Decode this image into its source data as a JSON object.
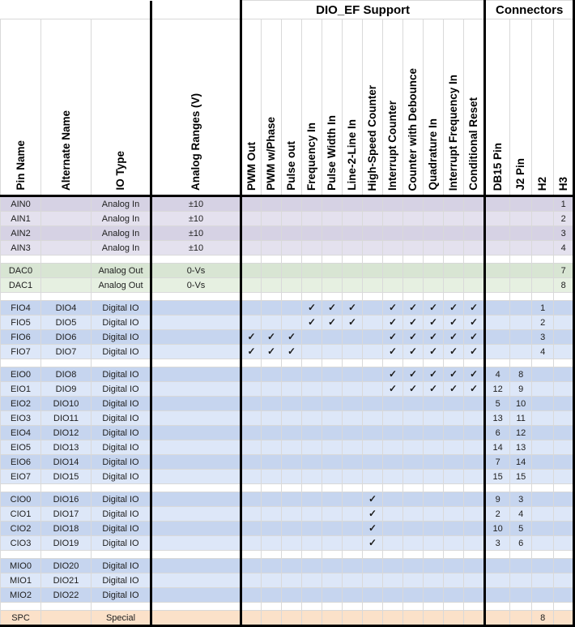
{
  "banners": {
    "dio_ef": "DIO_EF Support",
    "connectors": "Connectors"
  },
  "headers": {
    "pin_name": "Pin Name",
    "alternate_name": "Alternate Name",
    "io_type": "IO Type",
    "analog_ranges": "Analog Ranges (V)",
    "dio_ef": [
      "PWM Out",
      "PWM w/Phase",
      "Pulse out",
      "Frequency In",
      "Pulse Width In",
      "Line-2-Line In",
      "High-Speed Counter",
      "Interrupt Counter",
      "Counter with Debounce",
      "Quadrature In",
      "Interrupt Frequency In",
      "Conditional Reset"
    ],
    "connectors": [
      "DB15 Pin",
      "J2 Pin",
      "H2",
      "H3"
    ]
  },
  "check_glyph": "✓",
  "colors": {
    "analog_in_a": "#d6d2e4",
    "analog_in_b": "#e4e1ee",
    "analog_out_a": "#d8e5d3",
    "analog_out_b": "#e6f0e1",
    "digital_a": "#c6d5ef",
    "digital_b": "#dde7f8",
    "special": "#fbe1c9",
    "grid": "#d9d9d9",
    "section_border": "#000000"
  },
  "groups": [
    {
      "id": "analog-in",
      "tint": "ain",
      "rows": [
        {
          "pin": "AIN0",
          "alt": "",
          "io": "Analog In",
          "range": "±10",
          "ef": [
            0,
            0,
            0,
            0,
            0,
            0,
            0,
            0,
            0,
            0,
            0,
            0
          ],
          "conn": [
            "",
            "",
            "",
            "1"
          ]
        },
        {
          "pin": "AIN1",
          "alt": "",
          "io": "Analog In",
          "range": "±10",
          "ef": [
            0,
            0,
            0,
            0,
            0,
            0,
            0,
            0,
            0,
            0,
            0,
            0
          ],
          "conn": [
            "",
            "",
            "",
            "2"
          ]
        },
        {
          "pin": "AIN2",
          "alt": "",
          "io": "Analog In",
          "range": "±10",
          "ef": [
            0,
            0,
            0,
            0,
            0,
            0,
            0,
            0,
            0,
            0,
            0,
            0
          ],
          "conn": [
            "",
            "",
            "",
            "3"
          ]
        },
        {
          "pin": "AIN3",
          "alt": "",
          "io": "Analog In",
          "range": "±10",
          "ef": [
            0,
            0,
            0,
            0,
            0,
            0,
            0,
            0,
            0,
            0,
            0,
            0
          ],
          "conn": [
            "",
            "",
            "",
            "4"
          ]
        }
      ]
    },
    {
      "id": "analog-out",
      "tint": "dac",
      "rows": [
        {
          "pin": "DAC0",
          "alt": "",
          "io": "Analog Out",
          "range": "0-Vs",
          "ef": [
            0,
            0,
            0,
            0,
            0,
            0,
            0,
            0,
            0,
            0,
            0,
            0
          ],
          "conn": [
            "",
            "",
            "",
            "7"
          ]
        },
        {
          "pin": "DAC1",
          "alt": "",
          "io": "Analog Out",
          "range": "0-Vs",
          "ef": [
            0,
            0,
            0,
            0,
            0,
            0,
            0,
            0,
            0,
            0,
            0,
            0
          ],
          "conn": [
            "",
            "",
            "",
            "8"
          ]
        }
      ]
    },
    {
      "id": "fio",
      "tint": "dig",
      "rows": [
        {
          "pin": "FIO4",
          "alt": "DIO4",
          "io": "Digital IO",
          "range": "",
          "ef": [
            0,
            0,
            0,
            1,
            1,
            1,
            0,
            1,
            1,
            1,
            1,
            1
          ],
          "conn": [
            "",
            "",
            "1",
            ""
          ]
        },
        {
          "pin": "FIO5",
          "alt": "DIO5",
          "io": "Digital IO",
          "range": "",
          "ef": [
            0,
            0,
            0,
            1,
            1,
            1,
            0,
            1,
            1,
            1,
            1,
            1
          ],
          "conn": [
            "",
            "",
            "2",
            ""
          ]
        },
        {
          "pin": "FIO6",
          "alt": "DIO6",
          "io": "Digital IO",
          "range": "",
          "ef": [
            1,
            1,
            1,
            0,
            0,
            0,
            0,
            1,
            1,
            1,
            1,
            1
          ],
          "conn": [
            "",
            "",
            "3",
            ""
          ]
        },
        {
          "pin": "FIO7",
          "alt": "DIO7",
          "io": "Digital IO",
          "range": "",
          "ef": [
            1,
            1,
            1,
            0,
            0,
            0,
            0,
            1,
            1,
            1,
            1,
            1
          ],
          "conn": [
            "",
            "",
            "4",
            ""
          ]
        }
      ]
    },
    {
      "id": "eio",
      "tint": "dig",
      "rows": [
        {
          "pin": "EIO0",
          "alt": "DIO8",
          "io": "Digital IO",
          "range": "",
          "ef": [
            0,
            0,
            0,
            0,
            0,
            0,
            0,
            1,
            1,
            1,
            1,
            1
          ],
          "conn": [
            "4",
            "8",
            "",
            ""
          ]
        },
        {
          "pin": "EIO1",
          "alt": "DIO9",
          "io": "Digital IO",
          "range": "",
          "ef": [
            0,
            0,
            0,
            0,
            0,
            0,
            0,
            1,
            1,
            1,
            1,
            1
          ],
          "conn": [
            "12",
            "9",
            "",
            ""
          ]
        },
        {
          "pin": "EIO2",
          "alt": "DIO10",
          "io": "Digital IO",
          "range": "",
          "ef": [
            0,
            0,
            0,
            0,
            0,
            0,
            0,
            0,
            0,
            0,
            0,
            0
          ],
          "conn": [
            "5",
            "10",
            "",
            ""
          ]
        },
        {
          "pin": "EIO3",
          "alt": "DIO11",
          "io": "Digital IO",
          "range": "",
          "ef": [
            0,
            0,
            0,
            0,
            0,
            0,
            0,
            0,
            0,
            0,
            0,
            0
          ],
          "conn": [
            "13",
            "11",
            "",
            ""
          ]
        },
        {
          "pin": "EIO4",
          "alt": "DIO12",
          "io": "Digital IO",
          "range": "",
          "ef": [
            0,
            0,
            0,
            0,
            0,
            0,
            0,
            0,
            0,
            0,
            0,
            0
          ],
          "conn": [
            "6",
            "12",
            "",
            ""
          ]
        },
        {
          "pin": "EIO5",
          "alt": "DIO13",
          "io": "Digital IO",
          "range": "",
          "ef": [
            0,
            0,
            0,
            0,
            0,
            0,
            0,
            0,
            0,
            0,
            0,
            0
          ],
          "conn": [
            "14",
            "13",
            "",
            ""
          ]
        },
        {
          "pin": "EIO6",
          "alt": "DIO14",
          "io": "Digital IO",
          "range": "",
          "ef": [
            0,
            0,
            0,
            0,
            0,
            0,
            0,
            0,
            0,
            0,
            0,
            0
          ],
          "conn": [
            "7",
            "14",
            "",
            ""
          ]
        },
        {
          "pin": "EIO7",
          "alt": "DIO15",
          "io": "Digital IO",
          "range": "",
          "ef": [
            0,
            0,
            0,
            0,
            0,
            0,
            0,
            0,
            0,
            0,
            0,
            0
          ],
          "conn": [
            "15",
            "15",
            "",
            ""
          ]
        }
      ]
    },
    {
      "id": "cio",
      "tint": "dig",
      "rows": [
        {
          "pin": "CIO0",
          "alt": "DIO16",
          "io": "Digital IO",
          "range": "",
          "ef": [
            0,
            0,
            0,
            0,
            0,
            0,
            1,
            0,
            0,
            0,
            0,
            0
          ],
          "conn": [
            "9",
            "3",
            "",
            ""
          ]
        },
        {
          "pin": "CIO1",
          "alt": "DIO17",
          "io": "Digital IO",
          "range": "",
          "ef": [
            0,
            0,
            0,
            0,
            0,
            0,
            1,
            0,
            0,
            0,
            0,
            0
          ],
          "conn": [
            "2",
            "4",
            "",
            ""
          ]
        },
        {
          "pin": "CIO2",
          "alt": "DIO18",
          "io": "Digital IO",
          "range": "",
          "ef": [
            0,
            0,
            0,
            0,
            0,
            0,
            1,
            0,
            0,
            0,
            0,
            0
          ],
          "conn": [
            "10",
            "5",
            "",
            ""
          ]
        },
        {
          "pin": "CIO3",
          "alt": "DIO19",
          "io": "Digital IO",
          "range": "",
          "ef": [
            0,
            0,
            0,
            0,
            0,
            0,
            1,
            0,
            0,
            0,
            0,
            0
          ],
          "conn": [
            "3",
            "6",
            "",
            ""
          ]
        }
      ]
    },
    {
      "id": "mio",
      "tint": "dig",
      "rows": [
        {
          "pin": "MIO0",
          "alt": "DIO20",
          "io": "Digital IO",
          "range": "",
          "ef": [
            0,
            0,
            0,
            0,
            0,
            0,
            0,
            0,
            0,
            0,
            0,
            0
          ],
          "conn": [
            "",
            "",
            "",
            ""
          ]
        },
        {
          "pin": "MIO1",
          "alt": "DIO21",
          "io": "Digital IO",
          "range": "",
          "ef": [
            0,
            0,
            0,
            0,
            0,
            0,
            0,
            0,
            0,
            0,
            0,
            0
          ],
          "conn": [
            "",
            "",
            "",
            ""
          ]
        },
        {
          "pin": "MIO2",
          "alt": "DIO22",
          "io": "Digital IO",
          "range": "",
          "ef": [
            0,
            0,
            0,
            0,
            0,
            0,
            0,
            0,
            0,
            0,
            0,
            0
          ],
          "conn": [
            "",
            "",
            "",
            ""
          ]
        }
      ]
    },
    {
      "id": "special",
      "tint": "spc",
      "rows": [
        {
          "pin": "SPC",
          "alt": "",
          "io": "Special",
          "range": "",
          "ef": [
            0,
            0,
            0,
            0,
            0,
            0,
            0,
            0,
            0,
            0,
            0,
            0
          ],
          "conn": [
            "",
            "",
            "8",
            ""
          ]
        }
      ]
    }
  ]
}
